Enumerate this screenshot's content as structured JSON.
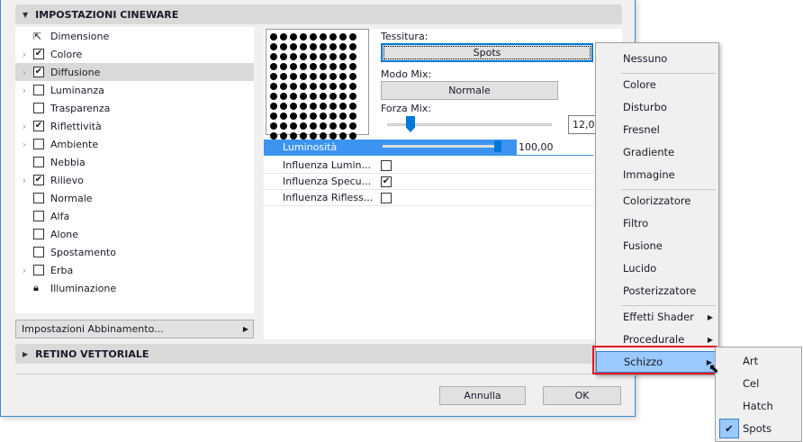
{
  "sections": {
    "cineware": "IMPOSTAZIONI CINEWARE",
    "retino": "RETINO VETTORIALE"
  },
  "channels": [
    {
      "label": "Dimensione",
      "icon": "dimension-icon"
    },
    {
      "label": "Colore",
      "expand": true,
      "checked": true
    },
    {
      "label": "Diffusione",
      "expand": true,
      "checked": true,
      "selected": true
    },
    {
      "label": "Luminanza",
      "expand": true,
      "checked": false
    },
    {
      "label": "Trasparenza",
      "checked": false
    },
    {
      "label": "Riflettività",
      "expand": true,
      "checked": true
    },
    {
      "label": "Ambiente",
      "expand": true,
      "checked": false
    },
    {
      "label": "Nebbia",
      "checked": false
    },
    {
      "label": "Rilievo",
      "expand": true,
      "checked": true
    },
    {
      "label": "Normale",
      "checked": false
    },
    {
      "label": "Alfa",
      "checked": false
    },
    {
      "label": "Alone",
      "checked": false
    },
    {
      "label": "Spostamento",
      "checked": false
    },
    {
      "label": "Erba",
      "expand": true,
      "checked": false
    },
    {
      "label": "Illuminazione",
      "icon": "lighting-icon"
    }
  ],
  "match_settings": "Impostazioni Abbinamento...",
  "texture": {
    "label": "Tessitura:",
    "value": "Spots"
  },
  "mix_mode": {
    "label": "Modo Mix:",
    "value": "Normale"
  },
  "mix_strength": {
    "label": "Forza Mix:",
    "value": "12,00",
    "fraction": 0.15
  },
  "luminosity": {
    "label": "Luminosità",
    "value": "100,00",
    "fraction": 1.0
  },
  "props": [
    {
      "label": "Influenza Lumin...",
      "checked": false
    },
    {
      "label": "Influenza Specu...",
      "checked": true
    },
    {
      "label": "Influenza Rifless...",
      "checked": false
    }
  ],
  "buttons": {
    "cancel": "Annulla",
    "ok": "OK"
  },
  "menu": [
    [
      "Nessuno"
    ],
    [
      "Colore",
      "Disturbo",
      "Fresnel",
      "Gradiente",
      "Immagine"
    ],
    [
      "Colorizzatore",
      "Filtro",
      "Fusione",
      "Lucido",
      "Posterizzatore"
    ],
    [
      "Effetti Shader",
      "Procedurale",
      "Schizzo"
    ]
  ],
  "submenu": [
    {
      "label": "Art"
    },
    {
      "label": "Cel"
    },
    {
      "label": "Hatch"
    },
    {
      "label": "Spots",
      "checked": true
    }
  ]
}
